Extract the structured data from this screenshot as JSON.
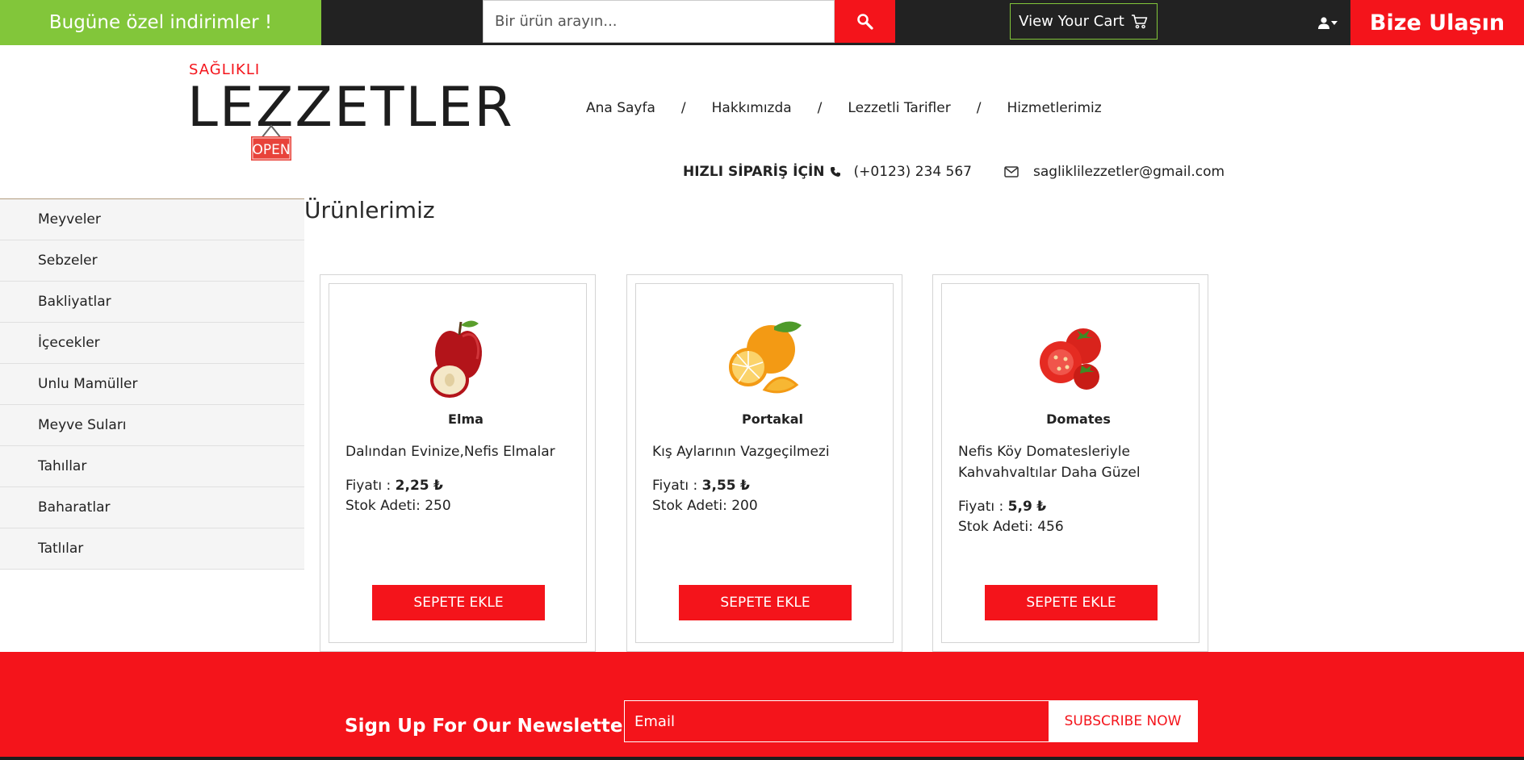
{
  "topbar": {
    "promo": "Bugüne özel indirimler !",
    "search_placeholder": "Bir ürün arayın...",
    "cart_label": "View Your Cart",
    "contact_label": "Bize Ulaşın"
  },
  "logo": {
    "small": "SAĞLIKLI",
    "big": "LEZZETLER",
    "sign": "OPEN"
  },
  "nav": {
    "items": [
      "Ana Sayfa",
      "Hakkımızda",
      "Lezzetli Tarifler",
      "Hizmetlerimiz"
    ],
    "separator": "/"
  },
  "contact": {
    "order_label": "HIZLI SİPARİŞ İÇİN",
    "phone": "(+0123) 234 567",
    "email": "sagliklilezzetler@gmail.com"
  },
  "sidebar": {
    "items": [
      "Meyveler",
      "Sebzeler",
      "Bakliyatlar",
      "İçecekler",
      "Unlu Mamüller",
      "Meyve Suları",
      "Tahıllar",
      "Baharatlar",
      "Tatlılar"
    ]
  },
  "products": {
    "title": "Ürünlerimiz",
    "price_label": "Fiyatı :",
    "currency": "₺",
    "stock_label": "Stok Adeti:",
    "button_label": "SEPETE EKLE",
    "items": [
      {
        "name": "Elma",
        "desc": "Dalından Evinize,Nefis Elmalar",
        "price": "2,25",
        "stock": "250"
      },
      {
        "name": "Portakal",
        "desc": "Kış Aylarının Vazgeçilmezi",
        "price": "3,55",
        "stock": "200"
      },
      {
        "name": "Domates",
        "desc": "Nefis Köy Domatesleriyle Kahvahvaltılar Daha Güzel",
        "price": "5,9",
        "stock": "456"
      }
    ]
  },
  "newsletter": {
    "title": "Sign Up For Our Newsletter",
    "email_placeholder": "Email",
    "button_label": "SUBSCRIBE NOW"
  },
  "colors": {
    "accent_red": "#f4141b",
    "promo_green": "#82c63a",
    "topbar_dark": "#222222"
  }
}
